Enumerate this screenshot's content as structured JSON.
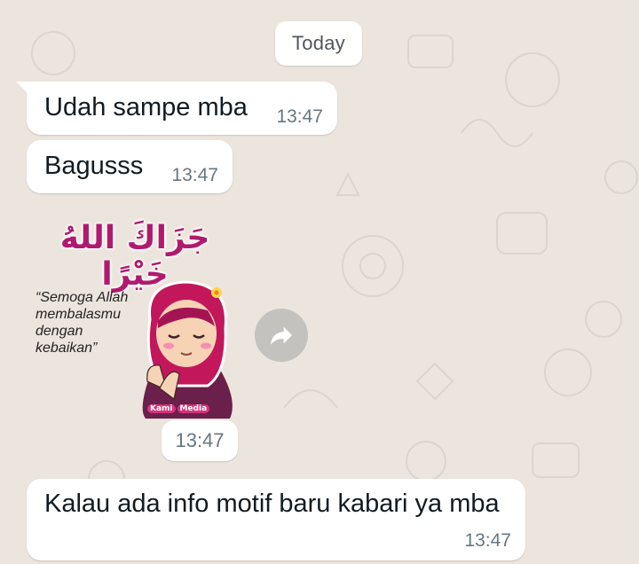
{
  "date_label": "Today",
  "messages": [
    {
      "text": "Udah sampe mba",
      "time": "13:47"
    },
    {
      "text": "Bagusss",
      "time": "13:47"
    },
    {
      "sticker": {
        "arabic": "جَزَاكَ اللهُ خَيْرًا",
        "quote": "“Semoga Allah\nmembalasmu\ndengan\nkebaikan”",
        "brand_a": "Kami",
        "brand_b": "Media"
      },
      "time": "13:47"
    },
    {
      "text": "Kalau ada info motif baru kabari ya mba",
      "time": "13:47"
    }
  ],
  "icons": {
    "forward": "forward-arrow-icon"
  },
  "colors": {
    "background": "#ece5dd",
    "bubble": "#ffffff",
    "timestamp": "#667781",
    "hijab": "#c2185b"
  }
}
